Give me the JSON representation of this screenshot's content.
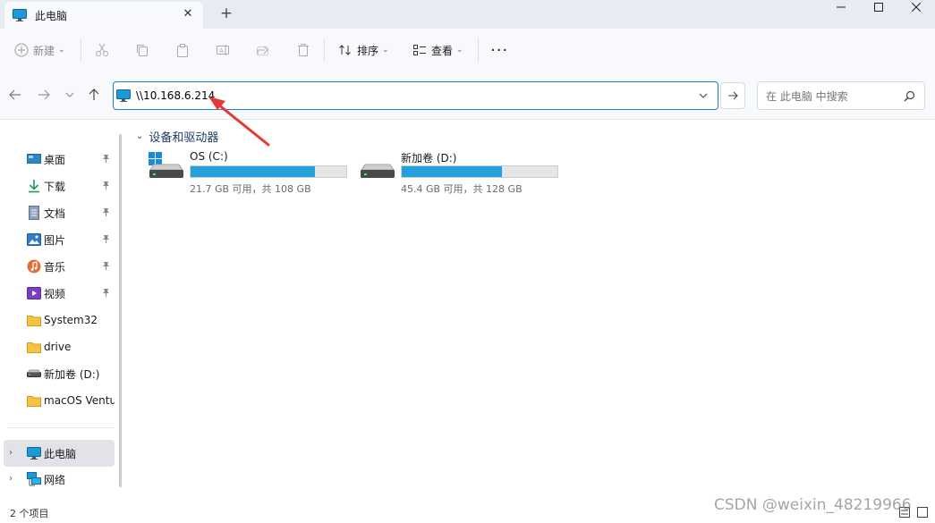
{
  "window": {
    "tab_title": "此电脑",
    "tab_close_glyph": "✕",
    "new_tab_glyph": "+",
    "min_glyph": "—",
    "max_glyph": "☐",
    "close_glyph": "✕"
  },
  "toolbar": {
    "new_label": "新建",
    "sort_label": "排序",
    "view_label": "查看",
    "more_glyph": "···",
    "caret": "⌄"
  },
  "address": {
    "path": "\\\\10.168.6.214",
    "search_placeholder": "在 此电脑 中搜索"
  },
  "sidebar": {
    "quick_access": [
      {
        "label": "桌面",
        "icon": "desktop-icon",
        "pinned": true
      },
      {
        "label": "下载",
        "icon": "download-icon",
        "pinned": true
      },
      {
        "label": "文档",
        "icon": "document-icon",
        "pinned": true
      },
      {
        "label": "图片",
        "icon": "pictures-icon",
        "pinned": true
      },
      {
        "label": "音乐",
        "icon": "music-icon",
        "pinned": true
      },
      {
        "label": "视频",
        "icon": "video-icon",
        "pinned": true
      },
      {
        "label": "System32",
        "icon": "folder-icon",
        "pinned": false
      },
      {
        "label": "drive",
        "icon": "folder-icon",
        "pinned": false
      },
      {
        "label": "新加卷 (D:)",
        "icon": "drive-icon",
        "pinned": false
      },
      {
        "label": "macOS Ventur",
        "icon": "folder-icon",
        "pinned": false
      }
    ],
    "this_pc": "此电脑",
    "network": "网络",
    "pin_glyph": "📌",
    "chev_glyph": "›"
  },
  "main": {
    "group_title": "设备和驱动器",
    "group_chev": "⌄",
    "drives": [
      {
        "name": "OS (C:)",
        "info": "21.7 GB 可用，共 108 GB",
        "used_fraction": 0.8,
        "icon": "windows-drive-icon"
      },
      {
        "name": "新加卷 (D:)",
        "info": "45.4 GB 可用，共 128 GB",
        "used_fraction": 0.645,
        "icon": "drive-icon"
      }
    ]
  },
  "status": {
    "item_count": "2 个项目"
  },
  "watermark": "CSDN @weixin_48219966",
  "colors": {
    "accent": "#1f7fc8",
    "bar_fill": "#26a0da",
    "annotation_arrow": "#e53935"
  }
}
